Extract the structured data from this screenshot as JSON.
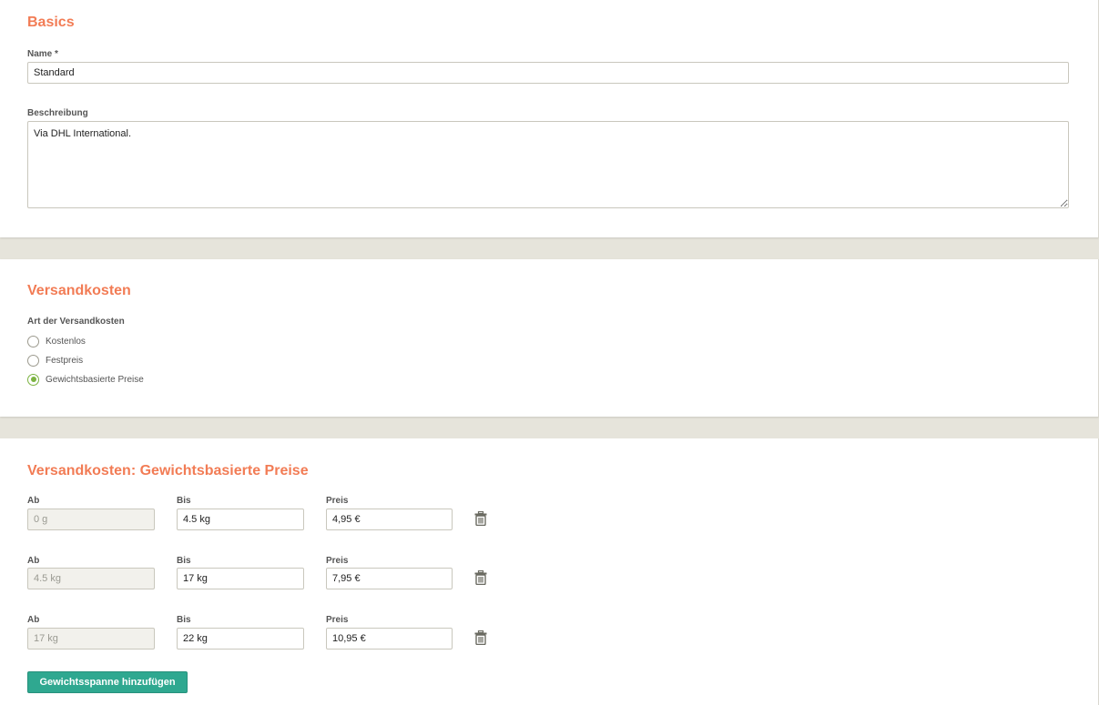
{
  "basics": {
    "title": "Basics",
    "name_label": "Name *",
    "name_value": "Standard",
    "description_label": "Beschreibung",
    "description_value": "Via DHL International."
  },
  "shipping": {
    "title": "Versandkosten",
    "type_label": "Art der Versandkosten",
    "options": [
      {
        "label": "Kostenlos",
        "selected": false
      },
      {
        "label": "Festpreis",
        "selected": false
      },
      {
        "label": "Gewichtsbasierte Preise",
        "selected": true
      }
    ]
  },
  "weight_prices": {
    "title": "Versandkosten: Gewichtsbasierte Preise",
    "from_label": "Ab",
    "to_label": "Bis",
    "price_label": "Preis",
    "rows": [
      {
        "from": "0 g",
        "to": "4.5 kg",
        "price": "4,95 €"
      },
      {
        "from": "4.5 kg",
        "to": "17 kg",
        "price": "7,95 €"
      },
      {
        "from": "17 kg",
        "to": "22 kg",
        "price": "10,95 €"
      }
    ],
    "delete_icon": "trash-icon",
    "add_button_label": "Gewichtsspanne hinzufügen"
  },
  "colors": {
    "section_title": "#f27c55",
    "radio_selected": "#7cb342",
    "add_button": "#2fa890",
    "background": "#e6e4db"
  }
}
